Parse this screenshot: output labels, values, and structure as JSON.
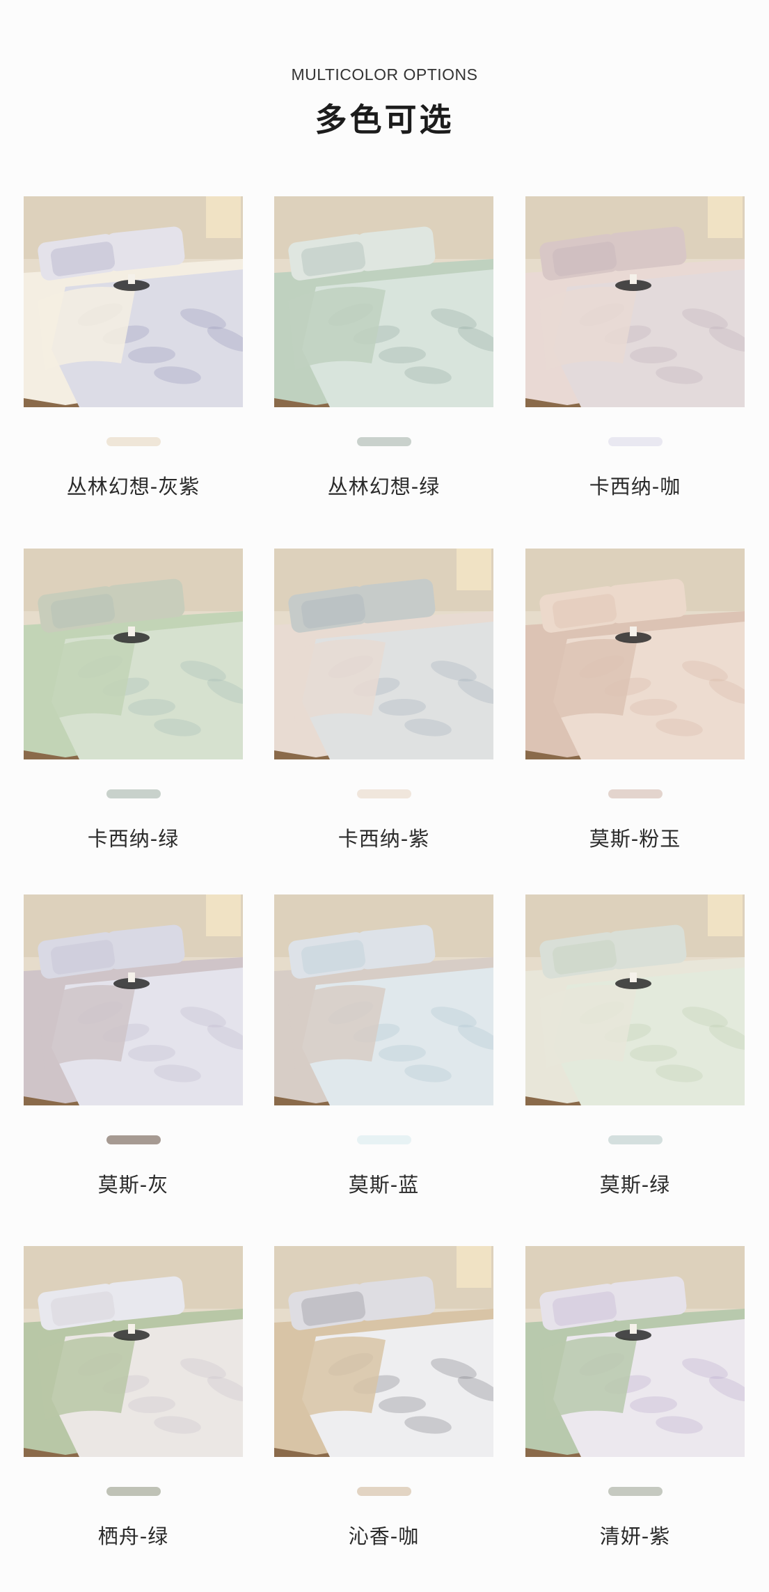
{
  "header": {
    "subtitle": "MULTICOLOR OPTIONS",
    "title": "多色可选"
  },
  "products": [
    {
      "name": "丛林幻想-灰紫",
      "swatch_color": "#efe6d8",
      "sheet": "#f4eee2",
      "duvet": "#dcdce6",
      "pattern": "#8f8fb2",
      "pillow": "#e4e2ea"
    },
    {
      "name": "丛林幻想-绿",
      "swatch_color": "#c9d1cc",
      "sheet": "#bfd1bf",
      "duvet": "#d8e4dc",
      "pattern": "#8aa39a",
      "pillow": "#dfe6e0"
    },
    {
      "name": "卡西纳-咖",
      "swatch_color": "#e9e8f1",
      "sheet": "#e9d9d4",
      "duvet": "#e3dadb",
      "pattern": "#b7a9b4",
      "pillow": "#d8c7c6"
    },
    {
      "name": "卡西纳-绿",
      "swatch_color": "#c8d1cb",
      "sheet": "#c2d4b6",
      "duvet": "#d6e1cf",
      "pattern": "#9fb6b4",
      "pillow": "#c8cdbb"
    },
    {
      "name": "卡西纳-紫",
      "swatch_color": "#f0e6dc",
      "sheet": "#e8dbd2",
      "duvet": "#dfe1e1",
      "pattern": "#9aa8b8",
      "pillow": "#c6cbc9"
    },
    {
      "name": "莫斯-粉玉",
      "swatch_color": "#e3d4cd",
      "sheet": "#dcc3b4",
      "duvet": "#eddcd0",
      "pattern": "#d3b2a0",
      "pillow": "#ecd9cb"
    },
    {
      "name": "莫斯-灰",
      "swatch_color": "#a69a92",
      "sheet": "#cfc4c8",
      "duvet": "#e4e3ec",
      "pattern": "#b9b3c9",
      "pillow": "#d9d9e4"
    },
    {
      "name": "莫斯-蓝",
      "swatch_color": "#e7f2f4",
      "sheet": "#d7cdc6",
      "duvet": "#e0e8ec",
      "pattern": "#a8c2cb",
      "pillow": "#dde2e8"
    },
    {
      "name": "莫斯-绿",
      "swatch_color": "#d4dfde",
      "sheet": "#e8e6d9",
      "duvet": "#e3eadc",
      "pattern": "#b6c9ad",
      "pillow": "#d9dfd7"
    },
    {
      "name": "栖舟-绿",
      "swatch_color": "#bfc2b6",
      "sheet": "#b8c7a6",
      "duvet": "#ebe7e4",
      "pattern": "#c6bec9",
      "pillow": "#e8e8ee"
    },
    {
      "name": "沁香-咖",
      "swatch_color": "#e2d4c3",
      "sheet": "#d8c4a6",
      "duvet": "#eeeef0",
      "pattern": "#6f6f76",
      "pillow": "#dedde2"
    },
    {
      "name": "清妍-紫",
      "swatch_color": "#c5c9c0",
      "sheet": "#b8c9ad",
      "duvet": "#ece8ee",
      "pattern": "#b3a1c9",
      "pillow": "#e6e2ea"
    }
  ]
}
